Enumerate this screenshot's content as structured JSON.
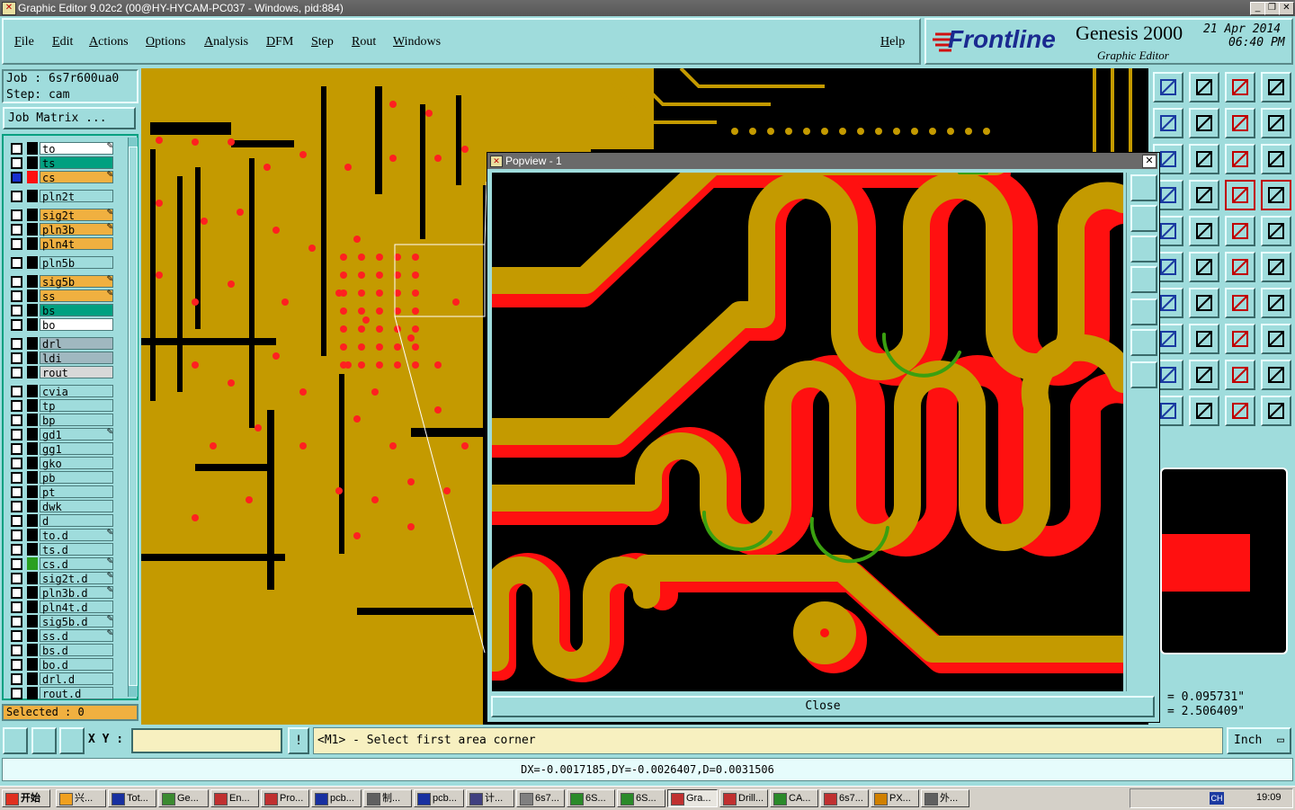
{
  "window": {
    "title": "Graphic Editor 9.02c2 (00@HY-HYCAM-PC037 - Windows, pid:884)"
  },
  "menu": [
    "File",
    "Edit",
    "Actions",
    "Options",
    "Analysis",
    "DFM",
    "Step",
    "Rout",
    "Windows"
  ],
  "help_label": "Help",
  "logo": {
    "brand": "Frontline",
    "product": "Genesis 2000",
    "subtitle": "Graphic Editor",
    "date": "21 Apr 2014",
    "time": "06:40 PM"
  },
  "job": {
    "job_text": "Job : 6s7r600ua0",
    "step_text": "Step: cam",
    "matrix_button": "Job Matrix ..."
  },
  "layers": [
    {
      "name": "to",
      "bg": "#ffffff",
      "mark": "✎"
    },
    {
      "name": "ts",
      "bg": "#00a080",
      "mark": ""
    },
    {
      "name": "cs",
      "bg": "#f0b040",
      "mark": "✎",
      "active": true
    },
    {
      "name": "pln2t",
      "bg": "#9fdcdc",
      "mark": ""
    },
    {
      "name": "sig2t",
      "bg": "#f0b040",
      "mark": "✎"
    },
    {
      "name": "pln3b",
      "bg": "#f0b040",
      "mark": "✎"
    },
    {
      "name": "pln4t",
      "bg": "#f0b040",
      "mark": ""
    },
    {
      "name": "pln5b",
      "bg": "#9fdcdc",
      "mark": ""
    },
    {
      "name": "sig5b",
      "bg": "#f0b040",
      "mark": "✎"
    },
    {
      "name": "ss",
      "bg": "#f0b040",
      "mark": "✎"
    },
    {
      "name": "bs",
      "bg": "#00a080",
      "mark": ""
    },
    {
      "name": "bo",
      "bg": "#ffffff",
      "mark": ""
    },
    {
      "name": "drl",
      "bg": "#a0b8c0",
      "mark": ""
    },
    {
      "name": "ldi",
      "bg": "#a0b8c0",
      "mark": ""
    },
    {
      "name": "rout",
      "bg": "#d8d8d8",
      "mark": ""
    },
    {
      "name": "cvia",
      "bg": "#9fdcdc",
      "mark": ""
    },
    {
      "name": "tp",
      "bg": "#9fdcdc",
      "mark": ""
    },
    {
      "name": "bp",
      "bg": "#9fdcdc",
      "mark": ""
    },
    {
      "name": "gd1",
      "bg": "#9fdcdc",
      "mark": "✎"
    },
    {
      "name": "gg1",
      "bg": "#9fdcdc",
      "mark": ""
    },
    {
      "name": "gko",
      "bg": "#9fdcdc",
      "mark": ""
    },
    {
      "name": "pb",
      "bg": "#9fdcdc",
      "mark": ""
    },
    {
      "name": "pt",
      "bg": "#9fdcdc",
      "mark": ""
    },
    {
      "name": "dwk",
      "bg": "#9fdcdc",
      "mark": ""
    },
    {
      "name": "d",
      "bg": "#9fdcdc",
      "mark": ""
    },
    {
      "name": "to.d",
      "bg": "#9fdcdc",
      "mark": "✎"
    },
    {
      "name": "ts.d",
      "bg": "#9fdcdc",
      "mark": ""
    },
    {
      "name": "cs.d",
      "bg": "#9fdcdc",
      "mark": "✎"
    },
    {
      "name": "sig2t.d",
      "bg": "#9fdcdc",
      "mark": "✎"
    },
    {
      "name": "pln3b.d",
      "bg": "#9fdcdc",
      "mark": "✎"
    },
    {
      "name": "pln4t.d",
      "bg": "#9fdcdc",
      "mark": ""
    },
    {
      "name": "sig5b.d",
      "bg": "#9fdcdc",
      "mark": "✎"
    },
    {
      "name": "ss.d",
      "bg": "#9fdcdc",
      "mark": "✎"
    },
    {
      "name": "bs.d",
      "bg": "#9fdcdc",
      "mark": ""
    },
    {
      "name": "bo.d",
      "bg": "#9fdcdc",
      "mark": ""
    },
    {
      "name": "drl.d",
      "bg": "#9fdcdc",
      "mark": ""
    },
    {
      "name": "rout.d",
      "bg": "#9fdcdc",
      "mark": ""
    }
  ],
  "selected_text": "Selected : 0",
  "popview": {
    "title": "Popview - 1",
    "close_label": "Close"
  },
  "coords": {
    "x": "= 0.095731\"",
    "y": "= 2.506409\""
  },
  "bottom": {
    "xy_label": "X Y :",
    "xy_value": "",
    "prompt": "<M1> - Select first area corner",
    "unit": "Inch",
    "status": "DX=-0.0017185,DY=-0.0026407,D=0.0031506"
  },
  "taskbar": {
    "start": "开始",
    "items": [
      "兴...",
      "Tot...",
      "Ge...",
      "En...",
      "Pro...",
      "pcb...",
      "制...",
      "pcb...",
      "计...",
      "6s7...",
      "6S...",
      "6S...",
      "Gra...",
      "Drill...",
      "CA...",
      "6s7...",
      "PX...",
      "外..."
    ],
    "active_index": 12,
    "tray_lang": "CH",
    "clock": "19:09"
  },
  "colors": {
    "copper": "#c49a00",
    "red": "#ff1010",
    "green": "#3aa010",
    "board_bg": "#000000",
    "panel": "#9fdcdc"
  }
}
